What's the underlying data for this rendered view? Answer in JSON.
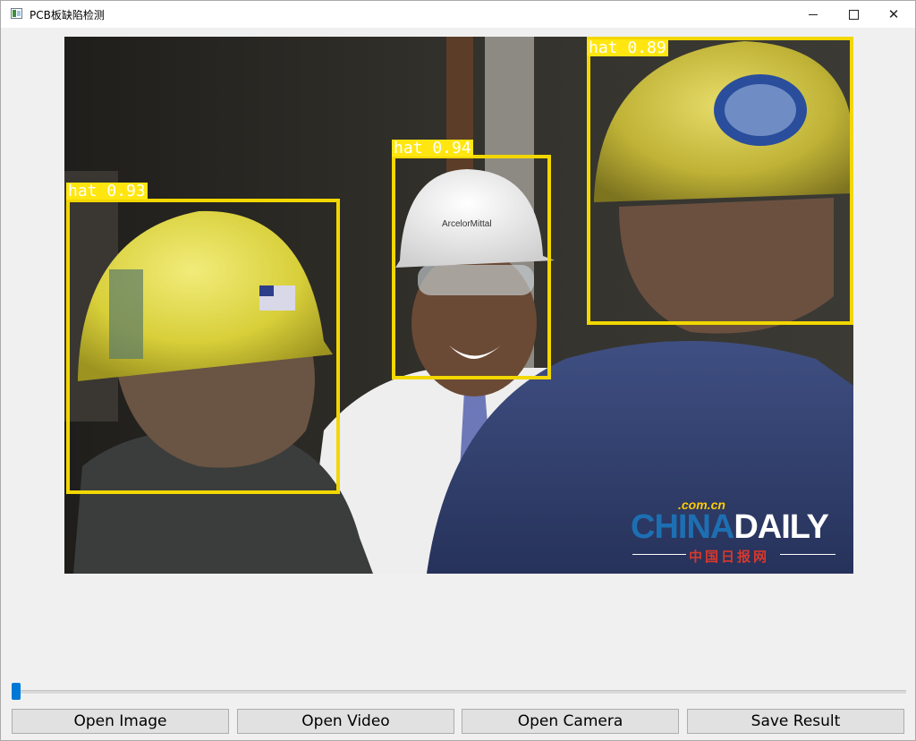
{
  "window": {
    "title": "PCB板缺陷检测",
    "controls": [
      "minimize",
      "maximize",
      "close"
    ],
    "close_glyph": "✕"
  },
  "image": {
    "detections": [
      {
        "label": "hat 0.93"
      },
      {
        "label": "hat 0.94"
      },
      {
        "label": "hat 0.89"
      }
    ],
    "box_color": "#f2d700",
    "watermark": {
      "dot": ".com.cn",
      "main_china": "CHINA",
      "main_daily": "DAILY",
      "sub": "中国日报网"
    },
    "helmet_text": "ArcelorMittal"
  },
  "slider": {
    "value": 0,
    "accent": "#0078d7"
  },
  "buttons": {
    "open_image": "Open Image",
    "open_video": "Open Video",
    "open_camera": "Open Camera",
    "save_result": "Save Result"
  }
}
